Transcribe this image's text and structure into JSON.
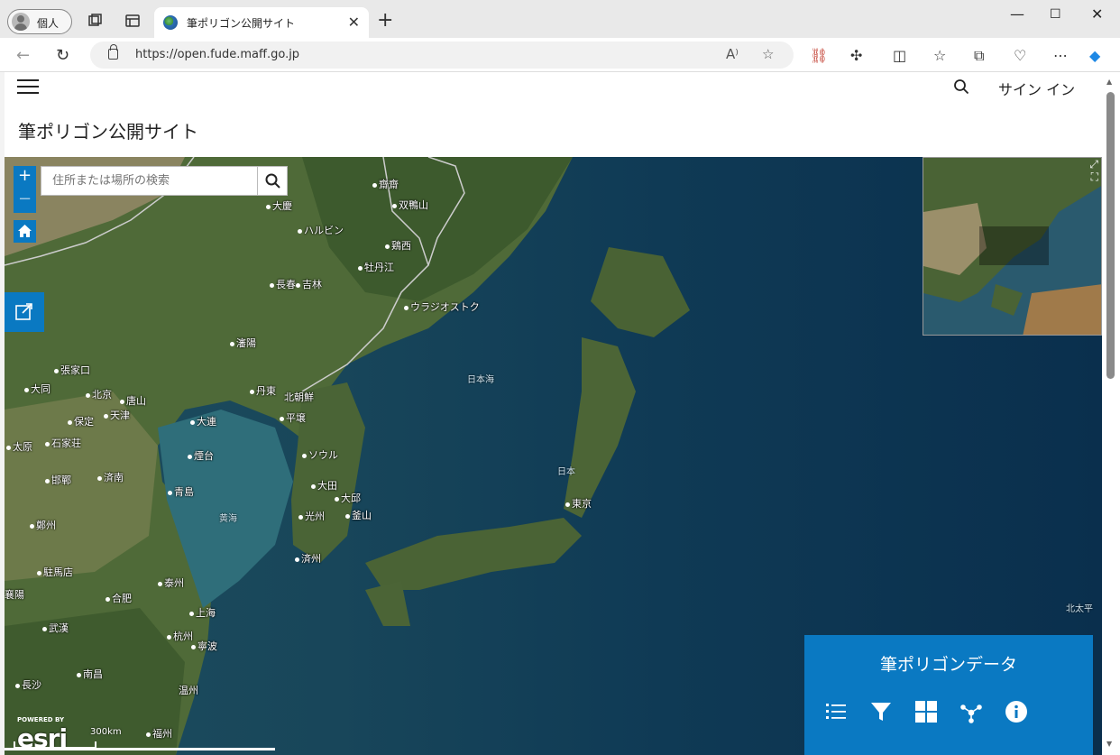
{
  "browser": {
    "profile_label": "個人",
    "tab_title": "筆ポリゴン公開サイト",
    "url": "https://open.fude.maff.go.jp"
  },
  "page": {
    "site_title": "筆ポリゴン公開サイト",
    "signin_label": "サイン イン"
  },
  "map": {
    "search_placeholder": "住所または場所の検索",
    "zoom_in": "+",
    "zoom_out": "−",
    "scale_label": "300km",
    "powered_by": "POWERED BY",
    "esri_logo": "esri",
    "cities": [
      "齋齋",
      "双鴨山",
      "大慶",
      "ハルビン",
      "鶏西",
      "牡丹江",
      "長春",
      "吉林",
      "ウラジオストク",
      "瀋陽",
      "張家口",
      "大同",
      "北京",
      "唐山",
      "丹東",
      "北朝鮮",
      "保定",
      "天津",
      "大連",
      "平壌",
      "太原",
      "石家荘",
      "煙台",
      "ソウル",
      "邯鄲",
      "済南",
      "大田",
      "大邱",
      "青島",
      "光州",
      "釜山",
      "鄭州",
      "済州",
      "駐馬店",
      "泰州",
      "合肥",
      "襄陽",
      "上海",
      "武漢",
      "杭州",
      "寧波",
      "南昌",
      "長沙",
      "温州",
      "福州",
      "東京"
    ],
    "sea_labels": [
      "日本海",
      "日本",
      "黄海",
      "北太平"
    ]
  },
  "data_panel": {
    "title": "筆ポリゴンデータ",
    "icons": [
      "list-icon",
      "filter-icon",
      "grid-icon",
      "share-network-icon",
      "info-icon"
    ]
  },
  "colors": {
    "accent": "#0a79c2"
  }
}
